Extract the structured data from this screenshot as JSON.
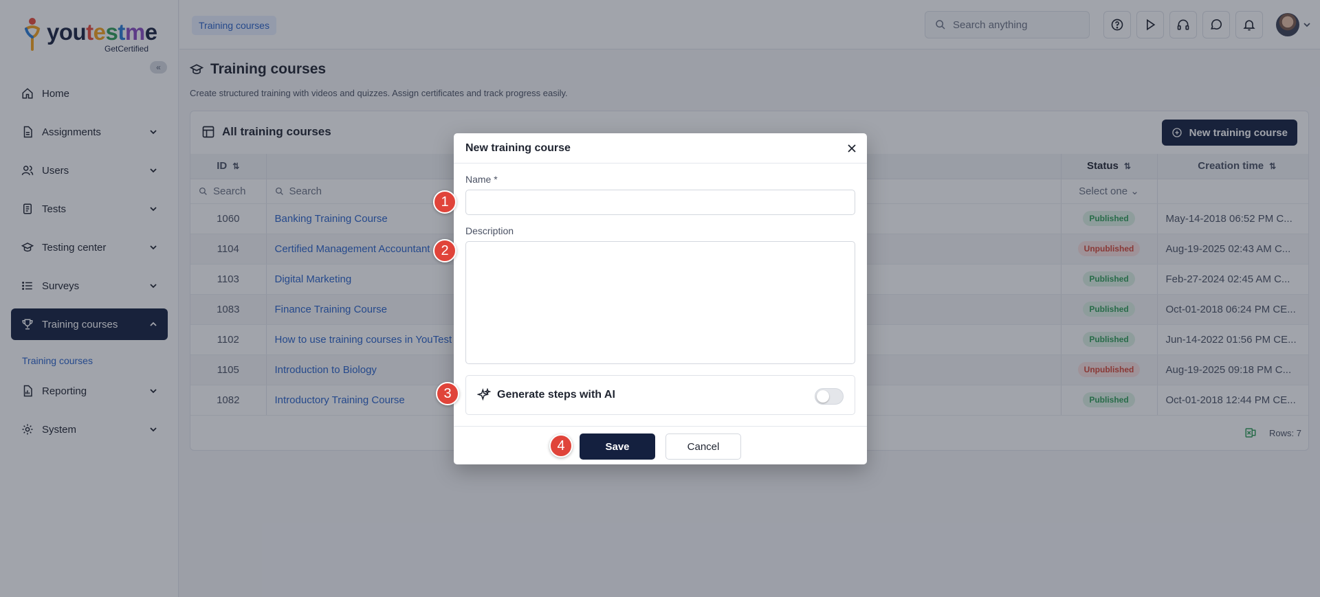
{
  "logo": {
    "word": [
      "you",
      "t",
      "e",
      "s",
      "t",
      "m",
      "e"
    ],
    "sub": "GetCertified"
  },
  "sidebar": {
    "items": [
      {
        "label": "Home",
        "icon": "home-icon",
        "expandable": false
      },
      {
        "label": "Assignments",
        "icon": "file-icon",
        "expandable": true
      },
      {
        "label": "Users",
        "icon": "users-icon",
        "expandable": true
      },
      {
        "label": "Tests",
        "icon": "clipboard-icon",
        "expandable": true
      },
      {
        "label": "Testing center",
        "icon": "graduation-cap-icon",
        "expandable": true
      },
      {
        "label": "Surveys",
        "icon": "list-icon",
        "expandable": true
      },
      {
        "label": "Training courses",
        "icon": "trophy-icon",
        "expandable": true,
        "active": true
      },
      {
        "label": "Reporting",
        "icon": "report-icon",
        "expandable": true
      },
      {
        "label": "System",
        "icon": "gear-icon",
        "expandable": true
      }
    ],
    "sub_item": "Training courses"
  },
  "topbar": {
    "breadcrumb": "Training courses",
    "search_placeholder": "Search anything"
  },
  "page": {
    "title": "Training courses",
    "description": "Create structured training with videos and quizzes. Assign certificates and track progress easily."
  },
  "card": {
    "title": "All training courses",
    "new_button": "New training course",
    "columns": {
      "id": "ID",
      "status": "Status",
      "creation_time": "Creation time"
    },
    "filters": {
      "id_placeholder": "Search",
      "name_placeholder": "Search",
      "status_placeholder": "Select one"
    },
    "rows": [
      {
        "id": "1060",
        "name": "Banking Training Course",
        "status": "Published",
        "time": "May-14-2018 06:52 PM C..."
      },
      {
        "id": "1104",
        "name": "Certified Management Accountant",
        "status": "Unpublished",
        "time": "Aug-19-2025 02:43 AM C..."
      },
      {
        "id": "1103",
        "name": "Digital Marketing",
        "status": "Published",
        "time": "Feb-27-2024 02:45 AM C..."
      },
      {
        "id": "1083",
        "name": "Finance Training Course",
        "status": "Published",
        "time": "Oct-01-2018 06:24 PM CE..."
      },
      {
        "id": "1102",
        "name": "How to use training courses in YouTest",
        "status": "Published",
        "time": "Jun-14-2022 01:56 PM CE..."
      },
      {
        "id": "1105",
        "name": "Introduction to Biology",
        "status": "Unpublished",
        "time": "Aug-19-2025 09:18 PM C..."
      },
      {
        "id": "1082",
        "name": "Introductory Training Course",
        "status": "Published",
        "time": "Oct-01-2018 12:44 PM CE..."
      }
    ],
    "rows_count": "Rows: 7"
  },
  "modal": {
    "title": "New training course",
    "name_label": "Name *",
    "name_value": "",
    "description_label": "Description",
    "description_value": "",
    "ai_label": "Generate steps with AI",
    "ai_enabled": false,
    "save_label": "Save",
    "cancel_label": "Cancel"
  },
  "steps": [
    "1",
    "2",
    "3",
    "4"
  ],
  "colors": {
    "accent": "#14203f",
    "link": "#2a62c9",
    "published": "#2f9e57",
    "unpublished": "#d64535",
    "step_marker": "#e0443a"
  }
}
